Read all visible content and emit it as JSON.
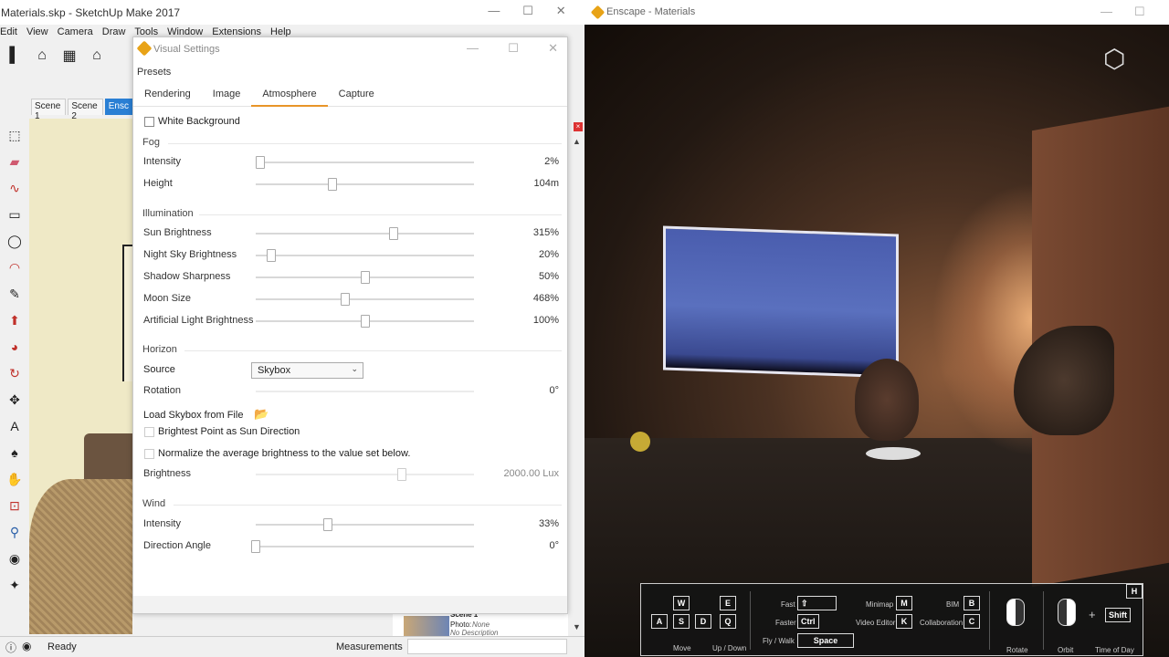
{
  "sketchup": {
    "title": "Materials.skp - SketchUp Make 2017",
    "menu": [
      "Edit",
      "View",
      "Camera",
      "Draw",
      "Tools",
      "Window",
      "Extensions",
      "Help"
    ],
    "scenes": [
      "Scene 1",
      "Scene 2",
      "Ensc"
    ],
    "status": "Ready",
    "measurements_label": "Measurements",
    "scene_panel": {
      "name": "Scene 1",
      "photo_label": "Photo:",
      "photo_value": "None",
      "description": "No Description"
    }
  },
  "visual_settings": {
    "title": "Visual Settings",
    "presets_label": "Presets",
    "tabs": [
      "Rendering",
      "Image",
      "Atmosphere",
      "Capture"
    ],
    "active_tab": "Atmosphere",
    "white_background_label": "White Background",
    "fog": {
      "section": "Fog",
      "rows": [
        {
          "label": "Intensity",
          "value": "2%",
          "level": 0.02
        },
        {
          "label": "Height",
          "value": "104m",
          "level": 0.35
        }
      ]
    },
    "illumination": {
      "section": "Illumination",
      "rows": [
        {
          "label": "Sun Brightness",
          "value": "315%",
          "level": 0.63
        },
        {
          "label": "Night Sky Brightness",
          "value": "20%",
          "level": 0.07
        },
        {
          "label": "Shadow Sharpness",
          "value": "50%",
          "level": 0.5
        },
        {
          "label": "Moon Size",
          "value": "468%",
          "level": 0.41
        },
        {
          "label": "Artificial Light Brightness",
          "value": "100%",
          "level": 0.5
        }
      ]
    },
    "horizon": {
      "section": "Horizon",
      "source_label": "Source",
      "source_value": "Skybox",
      "rotation_label": "Rotation",
      "rotation_value": "0°",
      "load_skybox_label": "Load Skybox from File",
      "brightest_point_label": "Brightest Point as Sun Direction",
      "normalize_label": "Normalize the average brightness to the value set below.",
      "brightness_label": "Brightness",
      "brightness_value": "2000.00 Lux"
    },
    "wind": {
      "section": "Wind",
      "rows": [
        {
          "label": "Intensity",
          "value": "33%",
          "level": 0.33
        },
        {
          "label": "Direction Angle",
          "value": "0°",
          "level": 0.0
        }
      ]
    }
  },
  "enscape": {
    "title": "Enscape - Materials",
    "hud": {
      "keys": {
        "w": "W",
        "a": "A",
        "s": "S",
        "d": "D",
        "e": "E",
        "q": "Q",
        "m": "M",
        "k": "K",
        "b": "B",
        "c": "C",
        "ctrl": "Ctrl",
        "space": "Space",
        "shift": "Shift",
        "h": "H"
      },
      "labels": {
        "move": "Move",
        "updown": "Up / Down",
        "fast": "Fast",
        "faster": "Faster",
        "flywalk": "Fly /  Walk",
        "minimap": "Minimap",
        "video_editor": "Video Editor",
        "bim": "BIM",
        "collaboration": "Collaboration",
        "rotate": "Rotate",
        "orbit": "Orbit",
        "time_of_day": "Time of Day",
        "plus": "+"
      }
    }
  }
}
